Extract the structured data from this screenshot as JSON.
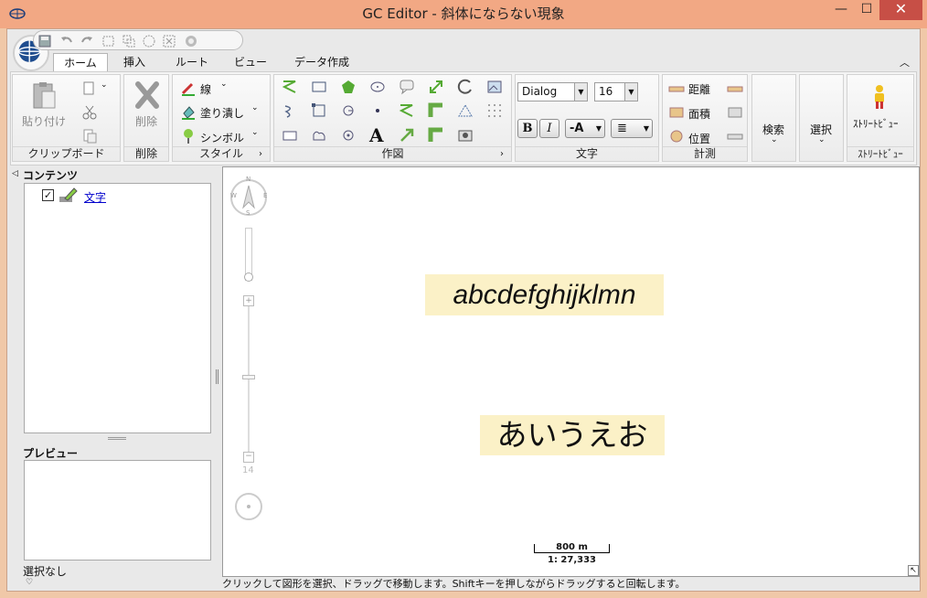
{
  "window": {
    "title": "GC Editor - 斜体にならない現象",
    "minimize": "—",
    "maximize": "☐",
    "close": "✕"
  },
  "tabs": [
    "ホーム",
    "挿入",
    "ルート",
    "ビュー",
    "データ作成"
  ],
  "groups": {
    "clipboard": {
      "label": "クリップボード",
      "paste": "貼り付け"
    },
    "delete": {
      "label": "削除",
      "button": "削除"
    },
    "style": {
      "label": "スタイル",
      "line": "線",
      "fill": "塗り潰し",
      "symbol": "シンボル"
    },
    "drawing": {
      "label": "作図"
    },
    "text": {
      "label": "文字",
      "font": "Dialog",
      "size": "16",
      "bold": "B",
      "italic": "I",
      "minusA": "-A"
    },
    "measure": {
      "label": "計測",
      "distance": "距離",
      "area": "面積",
      "position": "位置"
    },
    "search": {
      "label": "検索"
    },
    "select": {
      "label": "選択"
    },
    "streetview": {
      "label": "ｽﾄﾘｰﾄﾋﾞｭｰ",
      "button": "ｽﾄﾘｰﾄﾋﾞｭｰ"
    }
  },
  "contents": {
    "header": "コンテンツ",
    "item": "文字"
  },
  "preview": {
    "header": "プレビュー",
    "status": "選択なし"
  },
  "map": {
    "label_latin": "abcdefghijklmn",
    "label_kana": "あいうえお",
    "zoom_level": "14",
    "scale_distance": "800 m",
    "scale_ratio": "1: 27,333",
    "compass": {
      "n": "N",
      "s": "S",
      "e": "E",
      "w": "W"
    }
  },
  "statusbar": "クリックして図形を選択、ドラッグで移動します。Shiftキーを押しながらドラッグすると回転します。"
}
